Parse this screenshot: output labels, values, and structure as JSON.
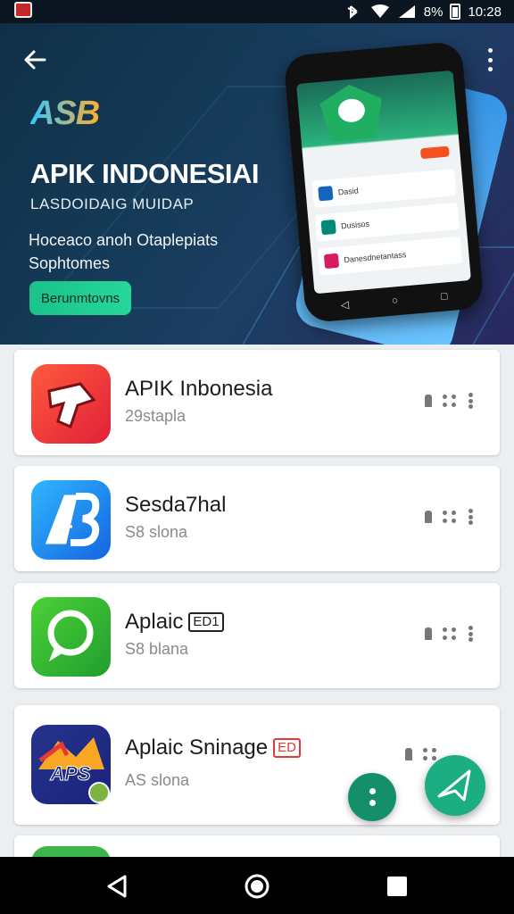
{
  "status_bar": {
    "battery": "8%",
    "time": "10:28"
  },
  "hero": {
    "logo_text": "ASB",
    "title": "APIK INDONESIAI",
    "subtitle": "LASDOIDAIG MUIDAP",
    "description": "Hoceaco anoh Otaplepiats Sophtomes",
    "button_label": "Berunmtovns",
    "phone_rows": [
      "Dasid",
      "Dusisos",
      "Danesdnetantass"
    ]
  },
  "apps": [
    {
      "name": "APIK Inbonesia",
      "meta": "29stapla",
      "badge": "",
      "icon": "apik-app-icon"
    },
    {
      "name": "Sesda7hal",
      "meta": "S8 slona",
      "badge": "",
      "icon": "ab-app-icon"
    },
    {
      "name": "Aplaic",
      "meta": "S8 blana",
      "badge": "ED1",
      "icon": "chat-app-icon"
    },
    {
      "name": "Aplaic Sninage",
      "meta": "AS slona",
      "badge": "ED",
      "icon": "aps-app-icon"
    }
  ],
  "colors": {
    "accent_green": "#1bae82",
    "hero_bg": "#153a57",
    "card_bg": "#ffffff"
  }
}
